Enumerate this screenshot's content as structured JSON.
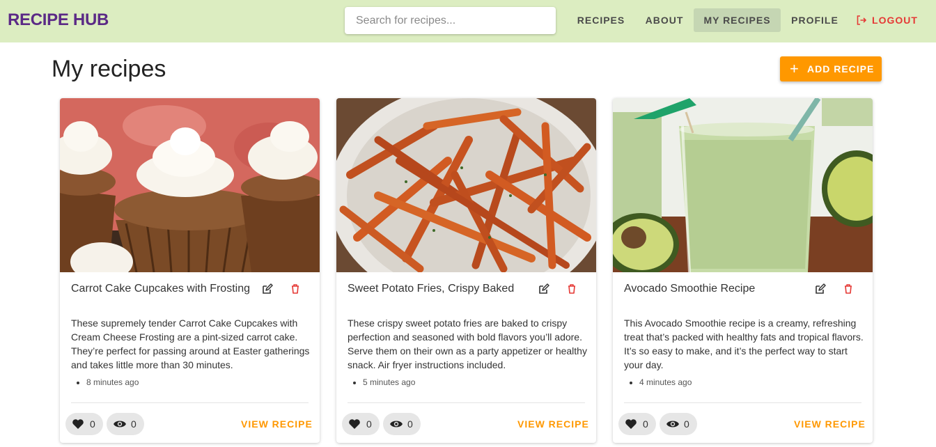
{
  "navbar": {
    "brand": "RECIPE HUB",
    "search_placeholder": "Search for recipes...",
    "items": [
      {
        "label": "RECIPES",
        "active": false
      },
      {
        "label": "ABOUT",
        "active": false
      },
      {
        "label": "MY RECIPES",
        "active": true
      },
      {
        "label": "PROFILE",
        "active": false
      }
    ],
    "logout_label": "LOGOUT"
  },
  "page": {
    "title": "My recipes",
    "add_button_label": "ADD RECIPE",
    "add_button_icon": "plus-icon"
  },
  "colors": {
    "navbar_bg": "#dcedc1",
    "brand": "#5b2a86",
    "accent": "#ff9800",
    "logout": "#e53935",
    "delete": "#e53935"
  },
  "recipes": [
    {
      "title": "Carrot Cake Cupcakes with Frosting",
      "description": "These supremely tender Carrot Cake Cupcakes with Cream Cheese Frosting are a pint-sized carrot cake. They’re perfect for passing around at Easter gatherings and takes little more than 30 minutes.",
      "time": "8 minutes ago",
      "likes": "0",
      "views": "0",
      "view_label": "VIEW RECIPE",
      "image": "carrot-cake-cupcakes-photo"
    },
    {
      "title": "Sweet Potato Fries, Crispy Baked",
      "description": "These crispy sweet potato fries are baked to crispy perfection and seasoned with bold flavors you’ll adore. Serve them on their own as a party appetizer or healthy snack. Air fryer instructions included.",
      "time": "5 minutes ago",
      "likes": "0",
      "views": "0",
      "view_label": "VIEW RECIPE",
      "image": "sweet-potato-fries-photo"
    },
    {
      "title": "Avocado Smoothie Recipe",
      "description": "This Avocado Smoothie recipe is a creamy, refreshing treat that’s packed with healthy fats and tropical flavors. It’s so easy to make, and it’s the perfect way to start your day.",
      "time": "4 minutes ago",
      "likes": "0",
      "views": "0",
      "view_label": "VIEW RECIPE",
      "image": "avocado-smoothie-photo"
    }
  ]
}
